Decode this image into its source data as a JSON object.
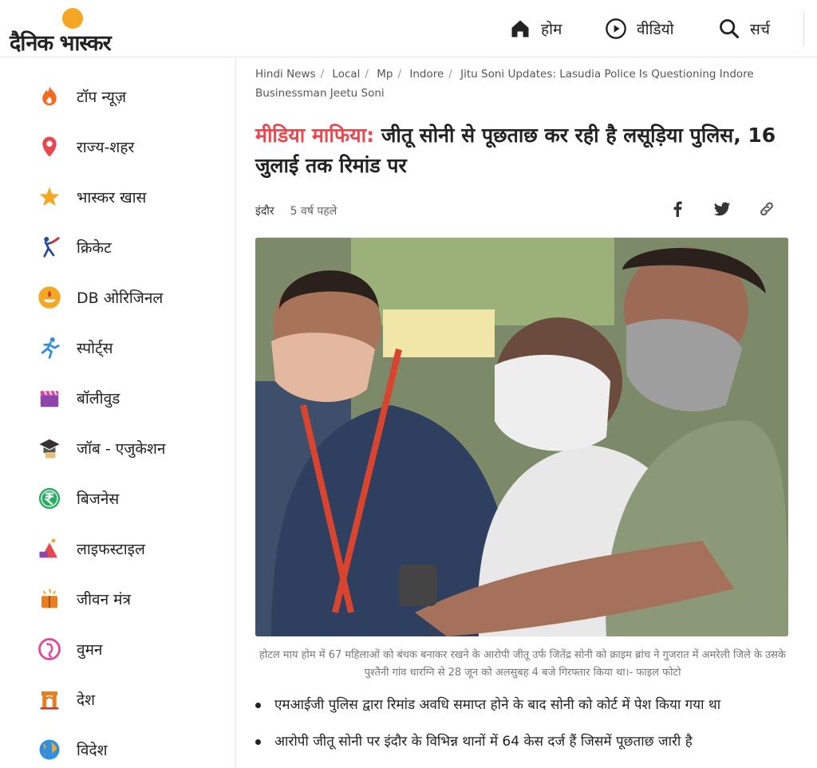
{
  "header": {
    "logo_text": "दैनिक भास्कर",
    "nav": [
      {
        "label": "होम",
        "icon": "home-icon"
      },
      {
        "label": "वीडियो",
        "icon": "play-icon"
      },
      {
        "label": "सर्च",
        "icon": "search-icon"
      }
    ]
  },
  "sidebar": {
    "items": [
      {
        "label": "टॉप न्यूज़",
        "icon": "flame-icon"
      },
      {
        "label": "राज्य-शहर",
        "icon": "location-pin-icon"
      },
      {
        "label": "भास्कर खास",
        "icon": "star-icon"
      },
      {
        "label": "क्रिकेट",
        "icon": "cricket-icon"
      },
      {
        "label": "DB ओरिजिनल",
        "icon": "lamp-icon"
      },
      {
        "label": "स्पोर्ट्स",
        "icon": "runner-icon"
      },
      {
        "label": "बॉलीवुड",
        "icon": "clapperboard-icon"
      },
      {
        "label": "जॉब - एजुकेशन",
        "icon": "graduation-cap-icon"
      },
      {
        "label": "बिजनेस",
        "icon": "rupee-icon"
      },
      {
        "label": "लाइफस्टाइल",
        "icon": "lifestyle-icon"
      },
      {
        "label": "जीवन मंत्र",
        "icon": "book-icon"
      },
      {
        "label": "वुमन",
        "icon": "woman-icon"
      },
      {
        "label": "देश",
        "icon": "india-gate-icon"
      },
      {
        "label": "विदेश",
        "icon": "globe-icon"
      }
    ]
  },
  "article": {
    "breadcrumb": [
      "Hindi News",
      "Local",
      "Mp",
      "Indore",
      "Jitu Soni Updates: Lasudia Police Is Questioning Indore Businessman Jeetu Soni"
    ],
    "kicker": "मीडिया माफिया:",
    "title": "जीतू सोनी से पूछताछ कर रही है लसूड़िया पुलिस, 16 जुलाई तक रिमांड पर",
    "city": "इंदौर",
    "time": "5 वर्ष पहले",
    "share_icons": [
      "facebook-icon",
      "twitter-icon",
      "link-icon"
    ],
    "caption": "होटल माय होम में 67 महिलाओं को बंधक बनाकर रखने के आरोपी जीतू उर्फ जितेंद्र सोनी को क्राइम ब्रांच ने गुजरात में अमरेली जिले के उसके पुश्तैनी गांव धारग्नि से 28 जून को अलसुबह 4 बजे गिरफ्तार किया था।- फाइल फोटो",
    "bullets": [
      "एमआईजी पुलिस द्वारा रिमांड अवधि समाप्त होने के बाद सोनी को कोर्ट में पेश किया गया था",
      "आरोपी जीतू सोनी पर इंदौर के विभिन्न थानों में 64 केस दर्ज हैं जिसमें पूछताछ जारी है"
    ]
  },
  "colors": {
    "accent": "#e8474e",
    "logo_sun": "#f5a623"
  }
}
